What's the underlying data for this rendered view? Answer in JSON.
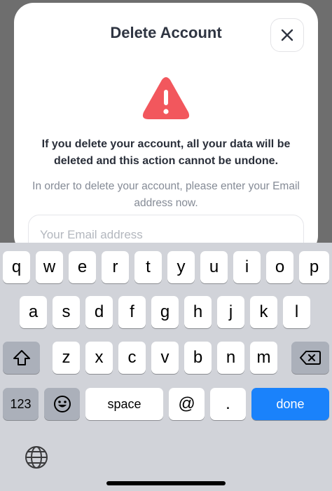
{
  "modal": {
    "title": "Delete Account",
    "close_icon": "close-icon",
    "warning_icon": "warning-triangle-icon",
    "warning_text": "If you delete your account, all your data will be deleted and this action cannot be undone.",
    "info_text": "In order to delete your account, please enter your Email address now.",
    "email_placeholder": "Your Email address",
    "email_value": ""
  },
  "keyboard": {
    "row1": [
      "q",
      "w",
      "e",
      "r",
      "t",
      "y",
      "u",
      "i",
      "o",
      "p"
    ],
    "row2": [
      "a",
      "s",
      "d",
      "f",
      "g",
      "h",
      "j",
      "k",
      "l"
    ],
    "row3": [
      "z",
      "x",
      "c",
      "v",
      "b",
      "n",
      "m"
    ],
    "shift_icon": "shift-icon",
    "backspace_icon": "backspace-icon",
    "numbers_label": "123",
    "emoji_icon": "emoji-icon",
    "space_label": "space",
    "at_label": "@",
    "dot_label": ".",
    "done_label": "done",
    "globe_icon": "globe-icon"
  },
  "colors": {
    "warning": "#f2575d",
    "done_button": "#1a82fb",
    "keyboard_bg": "#d1d3d9",
    "title": "#2f3542"
  }
}
